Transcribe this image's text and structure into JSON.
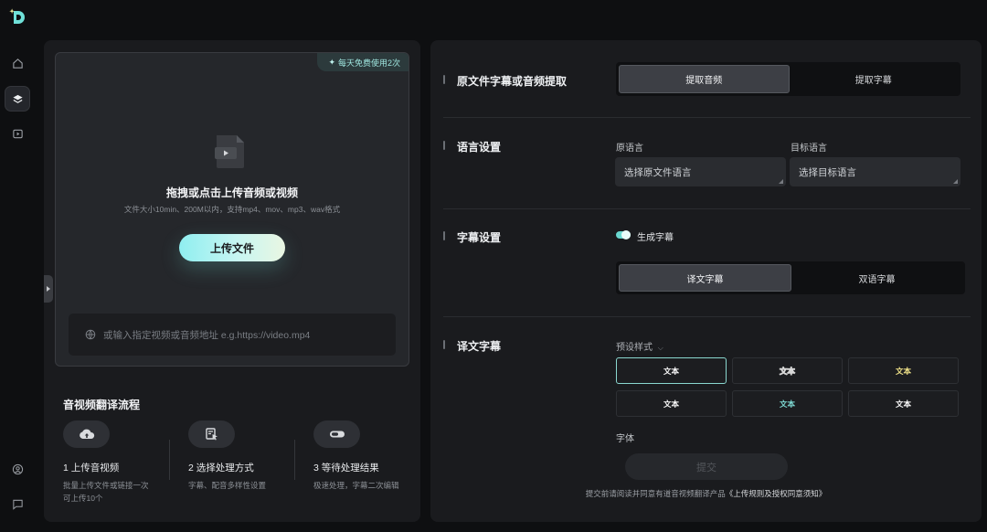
{
  "colors": {
    "accent": "#69d7cf",
    "panel": "#1a1b1e",
    "background": "#0e0f11"
  },
  "rail": {
    "items": [
      {
        "name": "home-icon",
        "active": false
      },
      {
        "name": "layers-icon",
        "active": true
      },
      {
        "name": "play-icon",
        "active": false
      }
    ],
    "bottom": [
      {
        "name": "user-icon"
      },
      {
        "name": "message-icon"
      }
    ]
  },
  "upload": {
    "badge": "每天免费使用2次",
    "title": "拖拽或点击上传音频或视频",
    "subtitle": "文件大小10min、200M以内，支持mp4、mov、mp3、wav格式",
    "button": "上传文件",
    "url_placeholder": "或输入指定视频或音频地址 e.g.https://video.mp4"
  },
  "flow": {
    "title": "音视频翻译流程",
    "steps": [
      {
        "label": "1 上传音视频",
        "desc": "批量上传文件或链接一次可上传10个",
        "icon": "cloud-upload-icon"
      },
      {
        "label": "2 选择处理方式",
        "desc": "字幕、配音多样性设置",
        "icon": "document-cursor-icon"
      },
      {
        "label": "3 等待处理结果",
        "desc": "极速处理，字幕二次编辑",
        "icon": "toggle-icon"
      }
    ]
  },
  "extract": {
    "title": "原文件字幕或音频提取",
    "options": [
      "提取音频",
      "提取字幕"
    ],
    "selected": "提取音频"
  },
  "language": {
    "title": "语言设置",
    "source_label": "原语言",
    "source_placeholder": "选择原文件语言",
    "target_label": "目标语言",
    "target_placeholder": "选择目标语言"
  },
  "subtitle": {
    "title": "字幕设置",
    "toggle_label": "生成字幕",
    "toggle_on": true,
    "options": [
      "译文字幕",
      "双语字幕"
    ],
    "selected": "译文字幕"
  },
  "translated": {
    "title": "译文字幕",
    "preset_label": "预设样式",
    "styles": [
      {
        "text": "文本",
        "color": "#ffffff"
      },
      {
        "text": "文本",
        "color": "#d9d9d9"
      },
      {
        "text": "文本",
        "color": "#f3e58a"
      },
      {
        "text": "文本",
        "color": "#ffffff"
      },
      {
        "text": "文本",
        "color": "#7fdcd6"
      },
      {
        "text": "文本",
        "color": "#ffffff"
      }
    ],
    "font_label": "字体",
    "submit": "提交",
    "agreement_prefix": "提交前请阅读并同意有道音视频翻译产品",
    "agreement_link": "《上传规则及授权同意须知》"
  }
}
